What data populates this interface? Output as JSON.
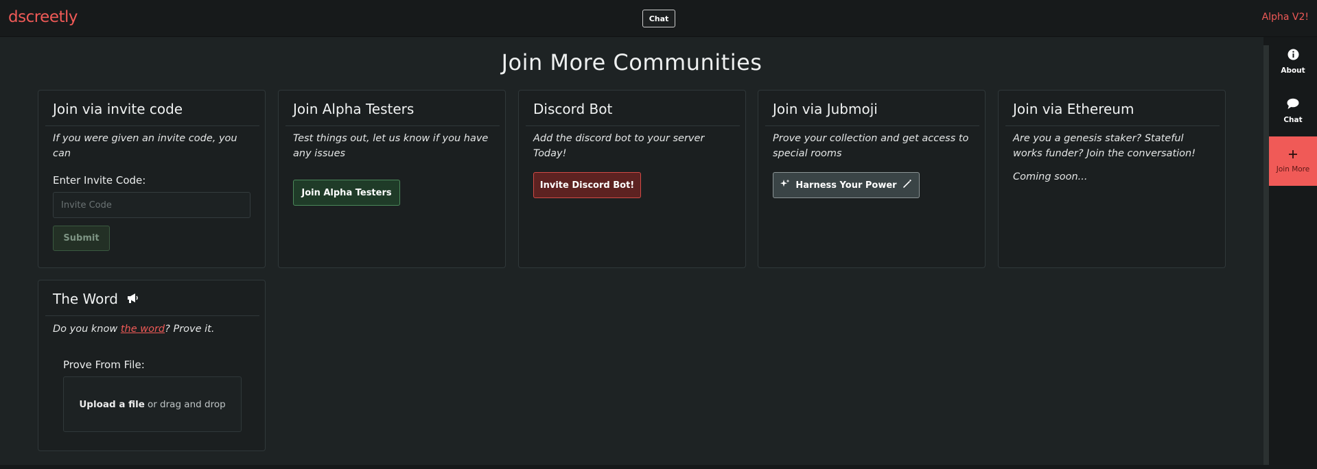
{
  "app": {
    "logo": "dscreetly",
    "top_chat_label": "Chat",
    "version": "Alpha V2!"
  },
  "page": {
    "title": "Join More Communities"
  },
  "cards": {
    "invite": {
      "title": "Join via invite code",
      "desc": "If you were given an invite code, you can",
      "field_label": "Enter Invite Code:",
      "placeholder": "Invite Code",
      "submit_label": "Submit"
    },
    "alpha": {
      "title": "Join Alpha Testers",
      "desc": "Test things out, let us know if you have any issues",
      "button_label": "Join Alpha Testers"
    },
    "discord": {
      "title": "Discord Bot",
      "desc": "Add the discord bot to your server Today!",
      "button_label": "Invite Discord Bot!"
    },
    "jubmoji": {
      "title": "Join via Jubmoji",
      "desc": "Prove your collection and get access to special rooms",
      "button_label": "Harness Your Power"
    },
    "ethereum": {
      "title": "Join via Ethereum",
      "desc": "Are you a genesis staker? Stateful works funder? Join the conversation!",
      "coming_soon": "Coming soon..."
    },
    "word": {
      "title": "The Word",
      "desc_before": "Do you know ",
      "desc_link": "the word",
      "desc_after": "? Prove it.",
      "field_label": "Prove From File:",
      "upload_strong": "Upload a file",
      "upload_rest": "or drag and drop"
    }
  },
  "nav": {
    "about": "About",
    "chat": "Chat",
    "join_more": "Join More"
  },
  "colors": {
    "accent": "#f05a57",
    "background": "#1e2324",
    "card": "#1b1f20"
  },
  "icons": [
    "info-icon",
    "chat-bubble-icon",
    "plus-icon",
    "megaphone-icon",
    "sparkles-icon",
    "magic-wand-icon"
  ]
}
